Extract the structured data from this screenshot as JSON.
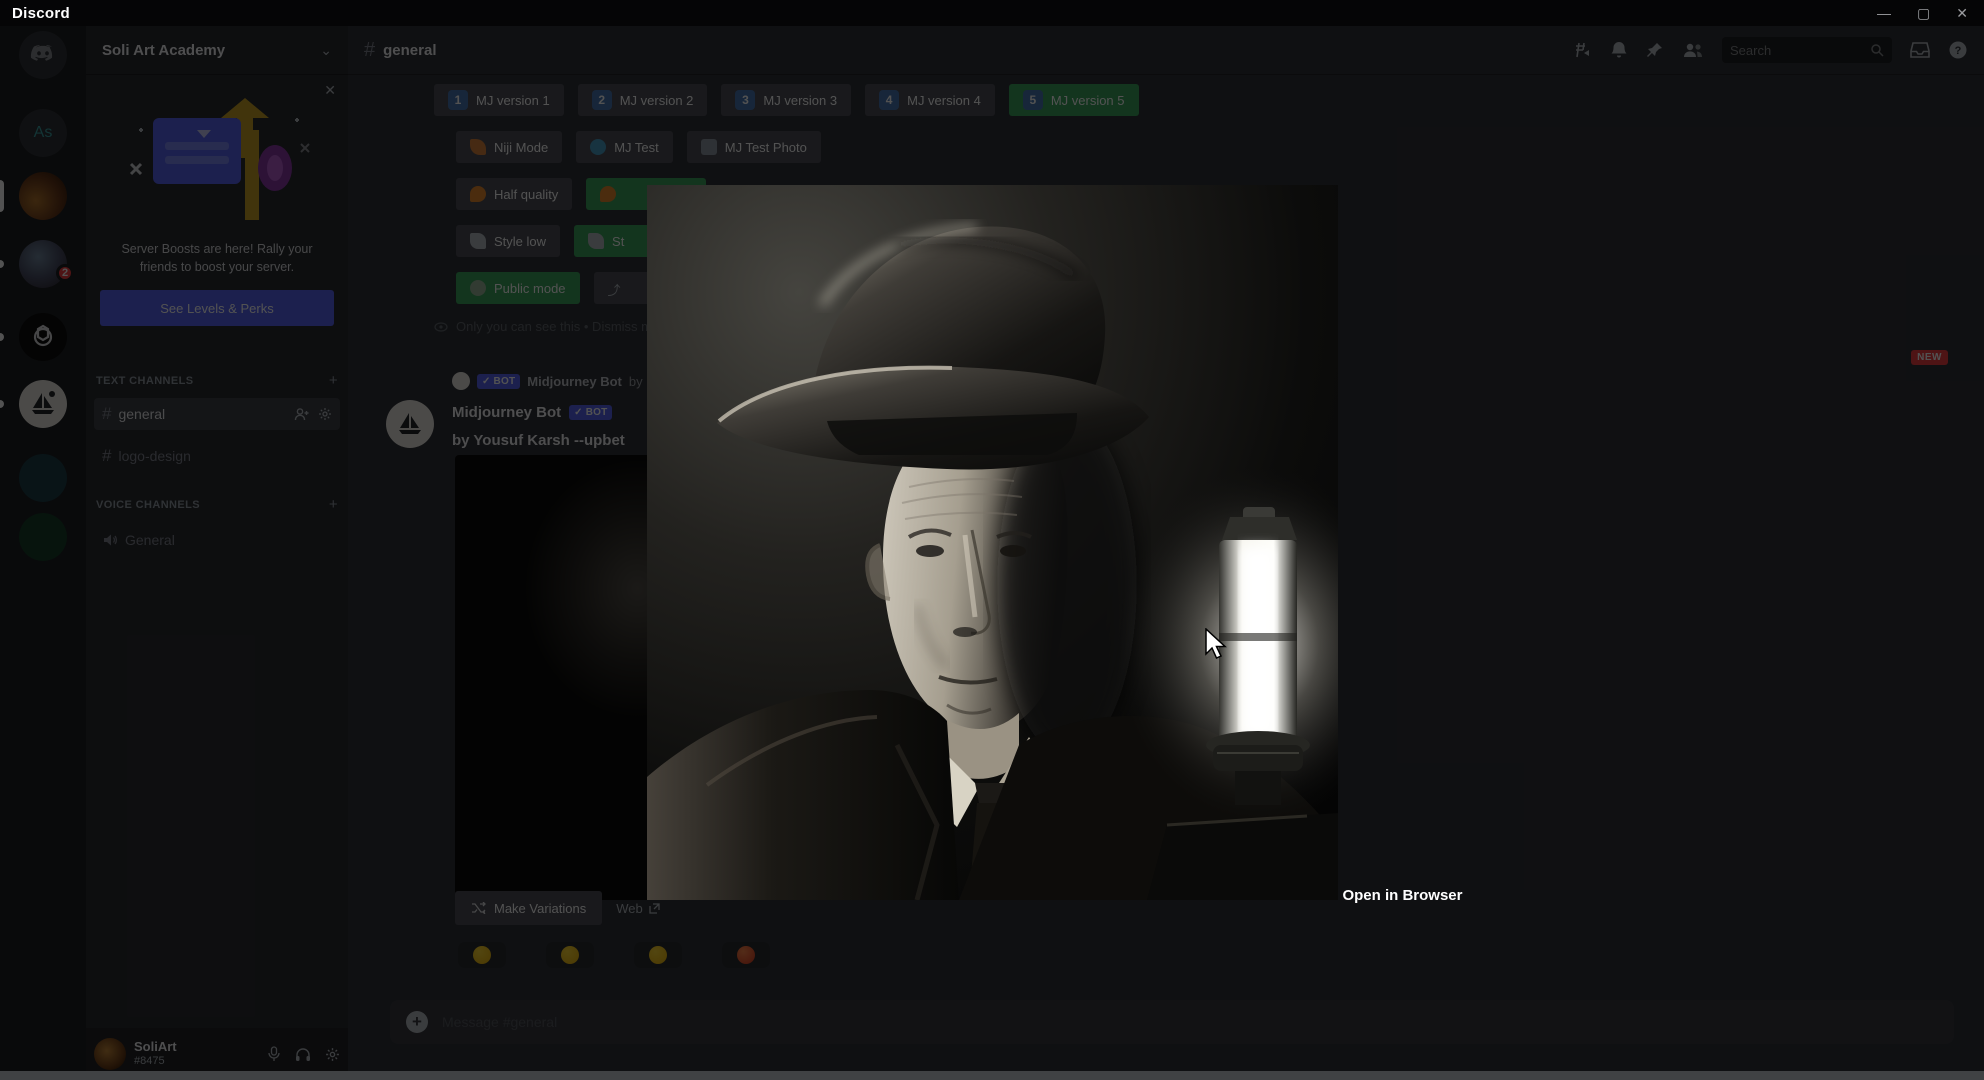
{
  "titlebar": {
    "app_name": "Discord",
    "minimize": "—",
    "maximize": "▢",
    "close": "✕"
  },
  "rail": {
    "as_label": "As",
    "badge_count": "2"
  },
  "sidebar": {
    "server_name": "Soli Art Academy",
    "chevron": "⌄",
    "boost": {
      "close": "✕",
      "text": "Server Boosts are here! Rally your friends to boost your server.",
      "button": "See Levels & Perks"
    },
    "text_section": "TEXT CHANNELS",
    "voice_section": "VOICE CHANNELS",
    "plus": "+",
    "hash": "#",
    "channels": [
      {
        "name": "general"
      },
      {
        "name": "logo-design"
      }
    ],
    "voice_channels": [
      {
        "name": "General"
      }
    ],
    "user": {
      "name": "SoliArt",
      "tag": "#8475"
    }
  },
  "header": {
    "hash": "#",
    "channel": "general",
    "search_placeholder": "Search"
  },
  "settings": {
    "versions": [
      {
        "num": "1",
        "label": "MJ version 1"
      },
      {
        "num": "2",
        "label": "MJ version 2"
      },
      {
        "num": "3",
        "label": "MJ version 3"
      },
      {
        "num": "4",
        "label": "MJ version 4"
      },
      {
        "num": "5",
        "label": "MJ version 5"
      }
    ],
    "row2": [
      {
        "label": "Niji Mode"
      },
      {
        "label": "MJ Test"
      },
      {
        "label": "MJ Test Photo"
      }
    ],
    "row3": [
      {
        "label": "Half quality"
      },
      {
        "label": ""
      }
    ],
    "row4": [
      {
        "label": "Style low"
      },
      {
        "label": "St"
      }
    ],
    "row5": [
      {
        "label": "Public mode"
      },
      {
        "label": "⤴"
      }
    ],
    "ephemeral": "Only you can see this • Dismiss message"
  },
  "chat": {
    "new_badge": "NEW",
    "reply": {
      "bot_badge": "✓ BOT",
      "author": "Midjourney Bot",
      "preview": "by"
    },
    "message": {
      "author": "Midjourney Bot",
      "bot_badge": "✓ BOT",
      "text": "by Yousuf Karsh --upbet"
    },
    "make_variations": "Make Variations",
    "web_label": "Web",
    "reactions": [
      {
        "emoji": "grinning-face"
      },
      {
        "emoji": "beaming-face"
      },
      {
        "emoji": "laughing-face"
      },
      {
        "emoji": "heart-eyes-face"
      }
    ],
    "input_placeholder": "Message #general"
  },
  "lightbox": {
    "link": "Open in Browser"
  },
  "colors": {
    "accent": "#5865f2",
    "success_green": "#3ba55d",
    "alert_red": "#f23f42"
  }
}
